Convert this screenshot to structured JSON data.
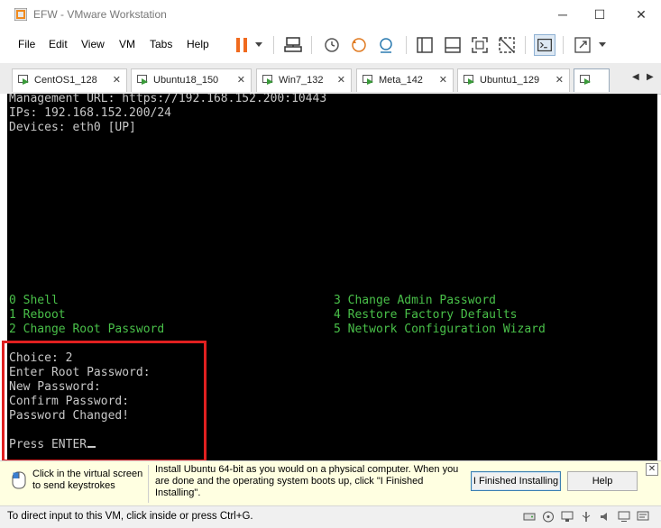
{
  "window": {
    "title": "EFW - VMware Workstation",
    "minimize": "─",
    "maximize": "☐",
    "close": "✕"
  },
  "menu": {
    "items": [
      "File",
      "Edit",
      "View",
      "VM",
      "Tabs",
      "Help"
    ]
  },
  "toolbar": {
    "icons": [
      "pause-icon",
      "dropdown-arrow-icon",
      "send-ctrl-alt-del-icon",
      "snapshot-icon",
      "revert-snapshot-icon",
      "snapshot-manager-icon",
      "library-icon",
      "thumbnail-bar-icon",
      "full-screen-icon",
      "unity-icon",
      "console-view-icon",
      "stretch-icon",
      "stretch-dropdown-icon"
    ]
  },
  "tabs": {
    "items": [
      {
        "label": "CentOS1_128",
        "close": "✕"
      },
      {
        "label": "Ubuntu18_150",
        "close": "✕"
      },
      {
        "label": "Win7_132",
        "close": "✕"
      },
      {
        "label": "Meta_142",
        "close": "✕"
      },
      {
        "label": "Ubuntu1_129",
        "close": "✕"
      }
    ],
    "scroll_left": "◀",
    "scroll_right": "▶"
  },
  "console": {
    "header": [
      "Management URL: https://192.168.152.200:10443",
      "IPs: 192.168.152.200/24",
      "Devices: eth0 [UP]"
    ],
    "menu_left": [
      "0 Shell",
      "1 Reboot",
      "2 Change Root Password"
    ],
    "menu_right": [
      "3 Change Admin Password",
      "4 Restore Factory Defaults",
      "5 Network Configuration Wizard"
    ],
    "session": [
      "Choice: 2",
      "Enter Root Password:",
      "New Password:",
      "Confirm Password:",
      "Password Changed!",
      "",
      "Press ENTER"
    ]
  },
  "hint": {
    "left_text": "Click in the virtual screen to send keystrokes",
    "message": "Install Ubuntu 64-bit as you would on a physical computer. When you are done and the operating system boots up, click \"I Finished Installing\".",
    "finished_button": "I Finished Installing",
    "help_button": "Help",
    "close": "✕"
  },
  "status": {
    "text": "To direct input to this VM, click inside or press Ctrl+G."
  },
  "colors": {
    "console_bg": "#000000",
    "console_text": "#c8c8c8",
    "console_menu": "#49c049",
    "highlight": "#e02020",
    "hint_bg": "#ffffe1",
    "pause_orange": "#f06a1e"
  }
}
